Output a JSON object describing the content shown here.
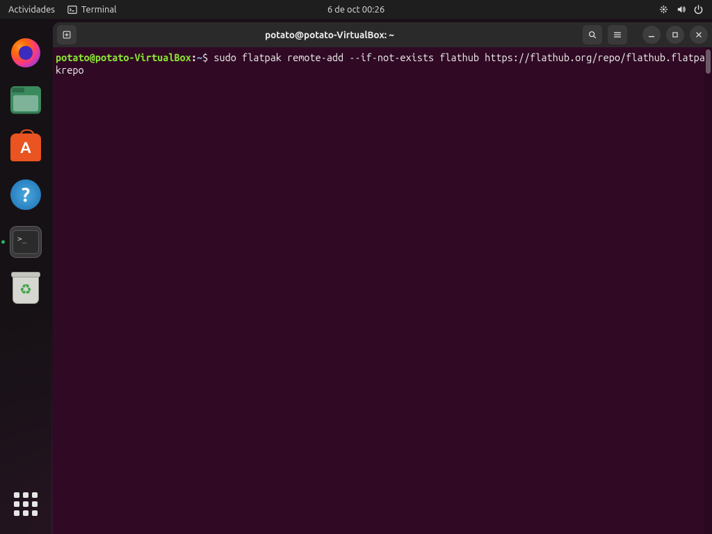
{
  "topbar": {
    "activities": "Actividades",
    "app_name": "Terminal",
    "datetime": "6 de oct  00:26"
  },
  "window": {
    "title": "potato@potato-VirtualBox: ~"
  },
  "prompt": {
    "user_host": "potato@potato-VirtualBox",
    "separator": ":",
    "path": "~",
    "symbol": "$ "
  },
  "command": "sudo flatpak remote-add --if-not-exists flathub https://flathub.org/repo/flathub.flatpakrepo",
  "icons": {
    "terminal_small": "terminal-icon",
    "network": "network-icon",
    "volume": "volume-icon",
    "power": "power-icon",
    "new_tab": "new-tab-icon",
    "search": "search-icon",
    "menu": "hamburger-menu-icon",
    "minimize": "minimize-icon",
    "maximize": "maximize-icon",
    "close": "close-icon"
  },
  "dock": {
    "items": [
      "firefox",
      "files",
      "software",
      "help",
      "terminal",
      "trash"
    ],
    "active": "terminal"
  }
}
